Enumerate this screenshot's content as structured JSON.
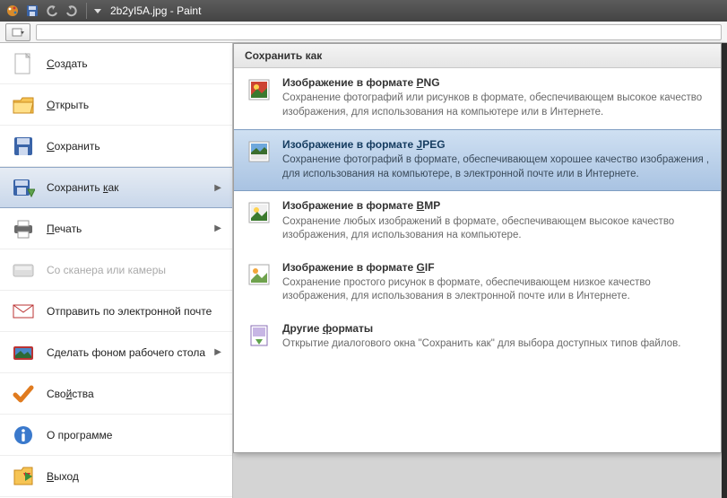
{
  "window": {
    "filename": "2b2yI5A.jpg",
    "appname": "Paint"
  },
  "menu": {
    "items": [
      {
        "key": "new",
        "label": "Создать",
        "ul": 0,
        "arrow": false,
        "disabled": false,
        "highlight": false,
        "icon": "new-doc-icon"
      },
      {
        "key": "open",
        "label": "Открыть",
        "ul": 0,
        "arrow": false,
        "disabled": false,
        "highlight": false,
        "icon": "open-folder-icon"
      },
      {
        "key": "save",
        "label": "Сохранить",
        "ul": 0,
        "arrow": false,
        "disabled": false,
        "highlight": false,
        "icon": "save-icon"
      },
      {
        "key": "saveas",
        "label": "Сохранить как",
        "ul": 10,
        "arrow": true,
        "disabled": false,
        "highlight": true,
        "icon": "saveas-icon"
      },
      {
        "key": "print",
        "label": "Печать",
        "ul": 0,
        "arrow": true,
        "disabled": false,
        "highlight": false,
        "icon": "print-icon"
      },
      {
        "key": "scanner",
        "label": "Со сканера или камеры",
        "ul": -1,
        "arrow": false,
        "disabled": true,
        "highlight": false,
        "icon": "scanner-icon"
      },
      {
        "key": "sendmail",
        "label": "Отправить по электронной почте",
        "ul": -1,
        "arrow": false,
        "disabled": false,
        "highlight": false,
        "icon": "mail-icon"
      },
      {
        "key": "wallpaper",
        "label": "Сделать фоном рабочего стола",
        "ul": -1,
        "arrow": true,
        "disabled": false,
        "highlight": false,
        "icon": "wallpaper-icon"
      },
      {
        "key": "props",
        "label": "Свойства",
        "ul": 3,
        "arrow": false,
        "disabled": false,
        "highlight": false,
        "icon": "check-icon"
      },
      {
        "key": "about",
        "label": "О программе",
        "ul": -1,
        "arrow": false,
        "disabled": false,
        "highlight": false,
        "icon": "info-icon"
      },
      {
        "key": "exit",
        "label": "Выход",
        "ul": 0,
        "arrow": false,
        "disabled": false,
        "highlight": false,
        "icon": "exit-icon"
      }
    ]
  },
  "submenu": {
    "title": "Сохранить как",
    "items": [
      {
        "key": "png",
        "icon": "png-icon",
        "title": "Изображение в формате PNG",
        "desc": "Сохранение фотографий или рисунков в формате, обеспечивающем высокое качество изображения, для использования на компьютере или в Интернете.",
        "selected": false
      },
      {
        "key": "jpeg",
        "icon": "jpeg-icon",
        "title": "Изображение в формате JPEG",
        "desc": "Сохранение фотографий в формате, обеспечивающем хорошее качество изображения , для использования на компьютере, в электронной почте или в Интернете.",
        "selected": true
      },
      {
        "key": "bmp",
        "icon": "bmp-icon",
        "title": "Изображение в формате BMP",
        "desc": "Сохранение любых изображений в формате, обеспечивающем высокое качество изображения, для использования на компьютере.",
        "selected": false
      },
      {
        "key": "gif",
        "icon": "gif-icon",
        "title": "Изображение в формате GIF",
        "desc": "Сохранение простого рисунок в формате, обеспечивающем низкое качество изображения, для использования в электронной почте или в Интернете.",
        "selected": false
      },
      {
        "key": "other",
        "icon": "other-format-icon",
        "title": "Другие форматы",
        "desc": "Открытие диалогового окна \"Сохранить как\" для выбора доступных типов файлов.",
        "selected": false
      }
    ]
  }
}
